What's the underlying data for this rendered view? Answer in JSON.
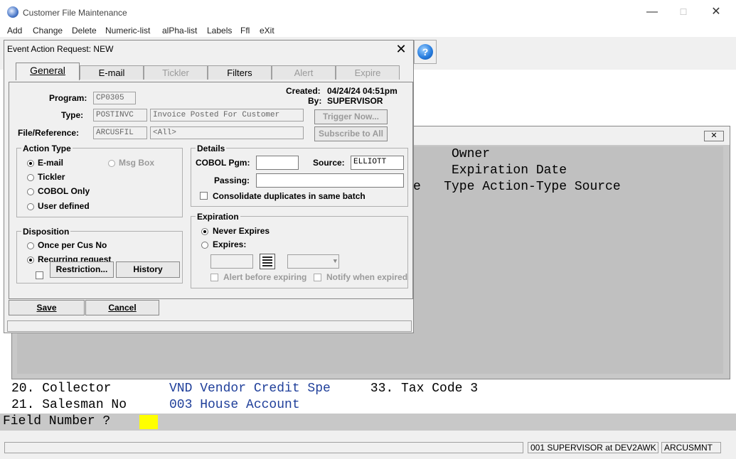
{
  "app": {
    "title": "Customer File Maintenance",
    "controls": {
      "minimize": "—",
      "maximize": "☐",
      "close": "✕"
    }
  },
  "menu": [
    "Add",
    "Change",
    "Delete",
    "Numeric-list",
    "alPha-list",
    "Labels",
    "Ffl",
    "eXit"
  ],
  "terminal": {
    "header_lines": [
      "Owner",
      "Expiration Date",
      "e   Type Action-Type Source"
    ],
    "rows": [
      {
        "num": "20. Collector   ",
        "value": "VND Vendor Credit Spe",
        "extra": " 33. Tax Code 3"
      },
      {
        "num": "21. Salesman No ",
        "value": "003 House Account",
        "extra": ""
      }
    ],
    "prompt": "Field Number ?"
  },
  "statusbar": {
    "user": "001 SUPERVISOR at DEV2AWK",
    "program": "ARCUSMNT"
  },
  "dialog": {
    "title": "Event Action Request: NEW",
    "close": "✕",
    "tabs": [
      {
        "label": "General",
        "enabled": true,
        "active": true
      },
      {
        "label": "E-mail",
        "enabled": true
      },
      {
        "label": "Tickler",
        "enabled": false
      },
      {
        "label": "Filters",
        "enabled": true
      },
      {
        "label": "Alert",
        "enabled": false
      },
      {
        "label": "Expire",
        "enabled": false
      }
    ],
    "general": {
      "program_label": "Program:",
      "program_value": "CP0305",
      "type_label": "Type:",
      "type_code": "POSTINVC",
      "type_desc": "Invoice Posted For Customer",
      "fileref_label": "File/Reference:",
      "fileref_value": "ARCUSFIL",
      "fileref_all": "<All>",
      "created_label": "Created:",
      "created_value": "04/24/24 04:51pm",
      "by_label": "By:",
      "by_value": "SUPERVISOR",
      "trigger_now": "Trigger Now...",
      "subscribe_all": "Subscribe to All"
    },
    "action_type": {
      "title": "Action Type",
      "options": [
        "E-mail",
        "Tickler",
        "COBOL Only",
        "User defined"
      ],
      "msg_box": "Msg Box"
    },
    "details": {
      "title": "Details",
      "cobol_pgm_label": "COBOL Pgm:",
      "cobol_pgm_value": "",
      "source_label": "Source:",
      "source_value": "ELLIOTT",
      "passing_label": "Passing:",
      "passing_value": "",
      "consolidate": "Consolidate duplicates in same batch"
    },
    "disposition": {
      "title": "Disposition",
      "once": "Once per Cus No",
      "recurring": "Recurring request",
      "restriction": "Restriction...",
      "history": "History"
    },
    "expiration": {
      "title": "Expiration",
      "never": "Never Expires",
      "expires": "Expires:",
      "alert_before": "Alert before expiring",
      "notify_when": "Notify when expired"
    },
    "save": "Save",
    "cancel": "Cancel"
  }
}
